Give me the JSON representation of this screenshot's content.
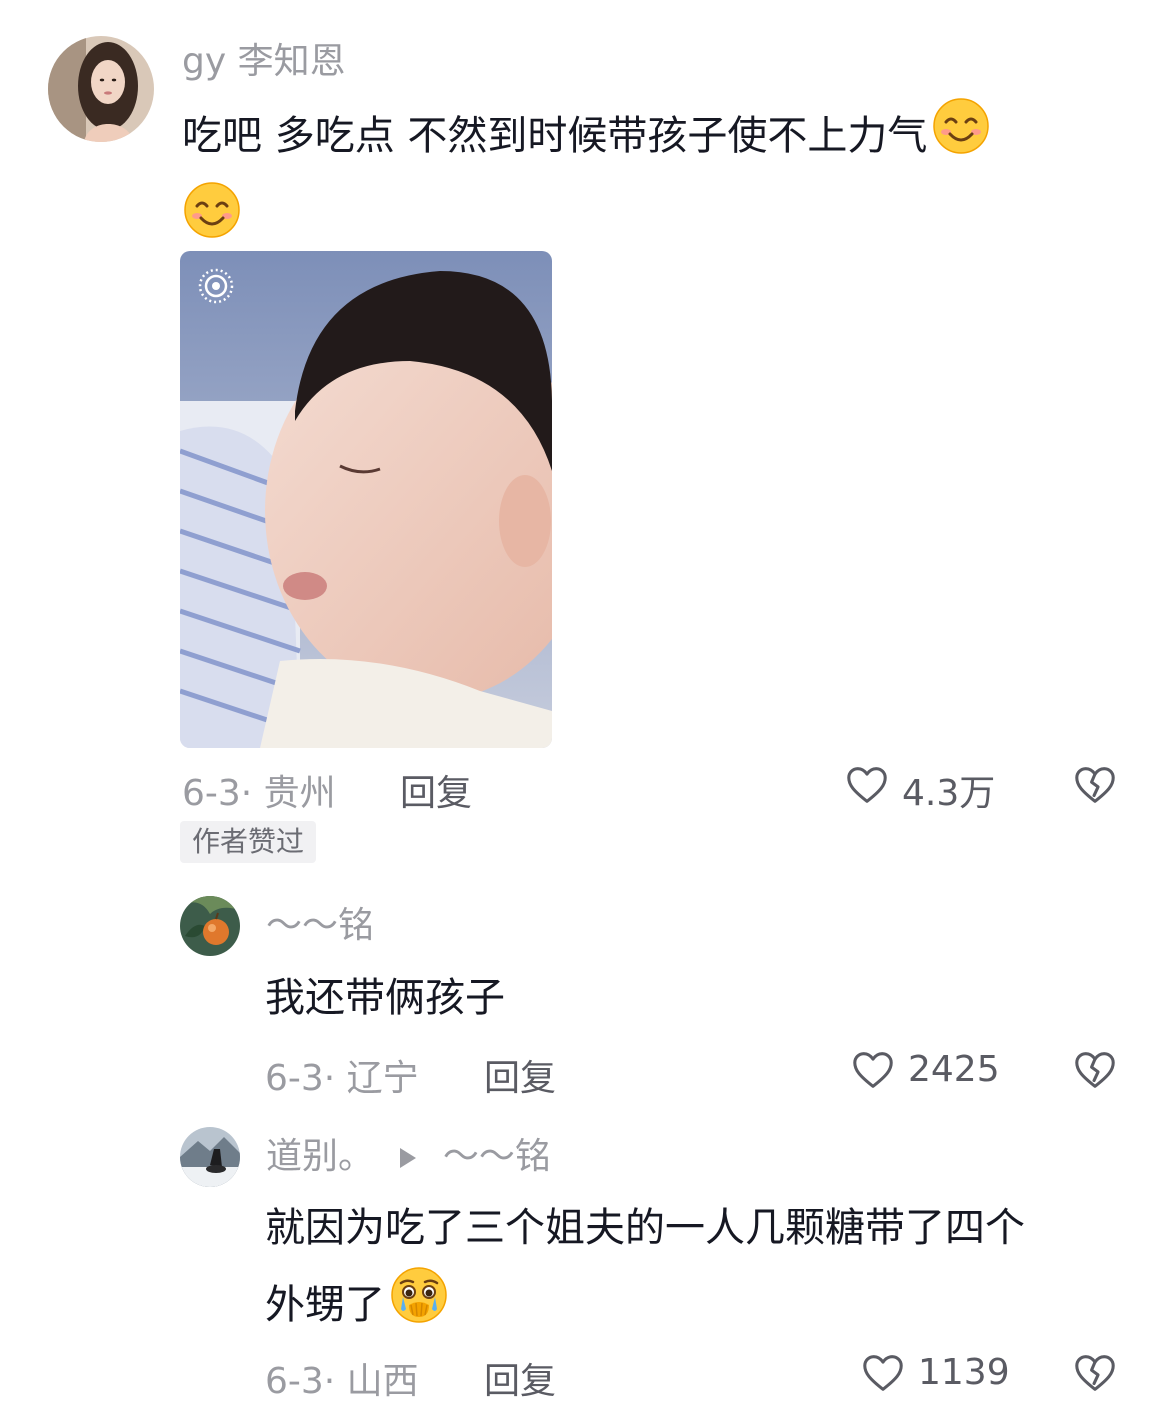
{
  "comments": [
    {
      "username": "gy 李知恩",
      "text": "吃吧 多吃点 不然到时候带孩子使不上力气",
      "emoji": "smiling-face-emoji",
      "meta": "6-3· 贵州",
      "reply_label": "回复",
      "likes": "4.3万",
      "badge": "作者赞过"
    },
    {
      "username": "～～铭",
      "text": "我还带俩孩子",
      "meta": "6-3· 辽宁",
      "reply_label": "回复",
      "likes": "2425"
    },
    {
      "username": "道别。",
      "reply_to": "～～铭",
      "text_line1": "就因为吃了三个姐夫的一人几颗糖带了四个",
      "text_line2": "外甥了",
      "emoji": "crying-face-emoji",
      "meta": "6-3· 山西",
      "reply_label": "回复",
      "likes": "1139"
    }
  ],
  "icons": {
    "like": "heart-outline-icon",
    "dislike": "broken-heart-icon",
    "live_photo": "live-photo-icon",
    "reply_arrow": "play-triangle-icon"
  },
  "colors": {
    "text": "#161823",
    "muted": "#9a9ba1",
    "secondary": "#5a5b63",
    "badge_bg": "#f1f1f3"
  }
}
